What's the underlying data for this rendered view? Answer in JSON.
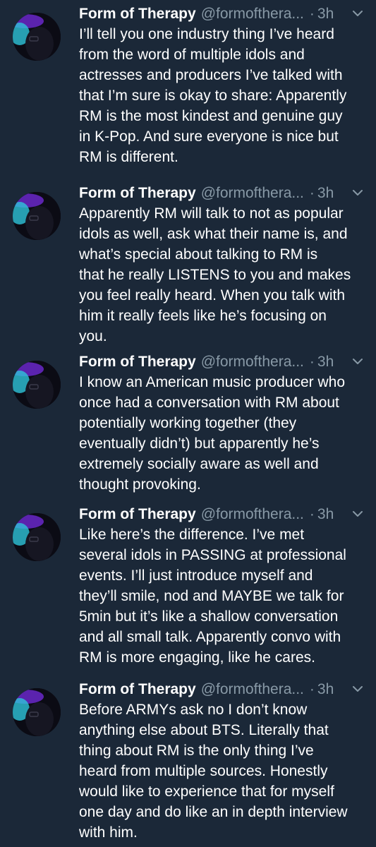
{
  "tweets": [
    {
      "author": "Form of Therapy",
      "handle": "@formofthera...",
      "separator": "·",
      "time": "3h",
      "lines": [
        "I’ll tell you one industry thing I’ve heard",
        "from the word of multiple idols and",
        "actresses and producers I’ve talked with",
        "that I’m sure is okay to share: Apparently",
        "RM is the most kindest and genuine guy",
        "in K-Pop. And sure everyone is nice but",
        "RM is different."
      ]
    },
    {
      "author": "Form of Therapy",
      "handle": "@formofthera...",
      "separator": "·",
      "time": "3h",
      "lines": [
        "Apparently RM will talk to not as popular",
        "idols as well, ask what their name is, and",
        "what’s special about talking to RM is",
        "that he really LISTENS to you and makes",
        "you feel really heard. When you talk with",
        "him it really feels like he’s focusing on",
        "you."
      ]
    },
    {
      "author": "Form of Therapy",
      "handle": "@formofthera...",
      "separator": "·",
      "time": "3h",
      "lines": [
        "I know an American music producer who",
        "once had a conversation with RM about",
        "potentially working together (they",
        "eventually didn’t) but apparently he’s",
        "extremely socially aware as well and",
        "thought provoking."
      ]
    },
    {
      "author": "Form of Therapy",
      "handle": "@formofthera...",
      "separator": "·",
      "time": "3h",
      "lines": [
        "Like here’s the difference. I’ve met",
        "several idols in PASSING at professional",
        "events. I’ll just introduce myself and",
        "they’ll smile, nod and MAYBE we talk for",
        "5min but it’s like a shallow conversation",
        "and all small talk. Apparently convo with",
        "RM is more engaging, like he cares."
      ]
    },
    {
      "author": "Form of Therapy",
      "handle": "@formofthera...",
      "separator": "·",
      "time": "3h",
      "lines": [
        "Before ARMYs ask no I don’t know",
        "anything else about BTS. Literally that",
        "thing about RM is the only thing I’ve",
        "heard from multiple sources. Honestly",
        "would like to experience that for myself",
        "one day and do like an in depth interview",
        "with him."
      ]
    }
  ],
  "icons": {
    "avatar": "avatar-icon",
    "menu": "chevron-down-icon"
  },
  "colors": {
    "background": "#1b2838",
    "text": "#ffffff",
    "secondary": "#8899a6",
    "avatar_accent_purple": "#7b2fd6",
    "avatar_accent_cyan": "#2ec4d9"
  }
}
